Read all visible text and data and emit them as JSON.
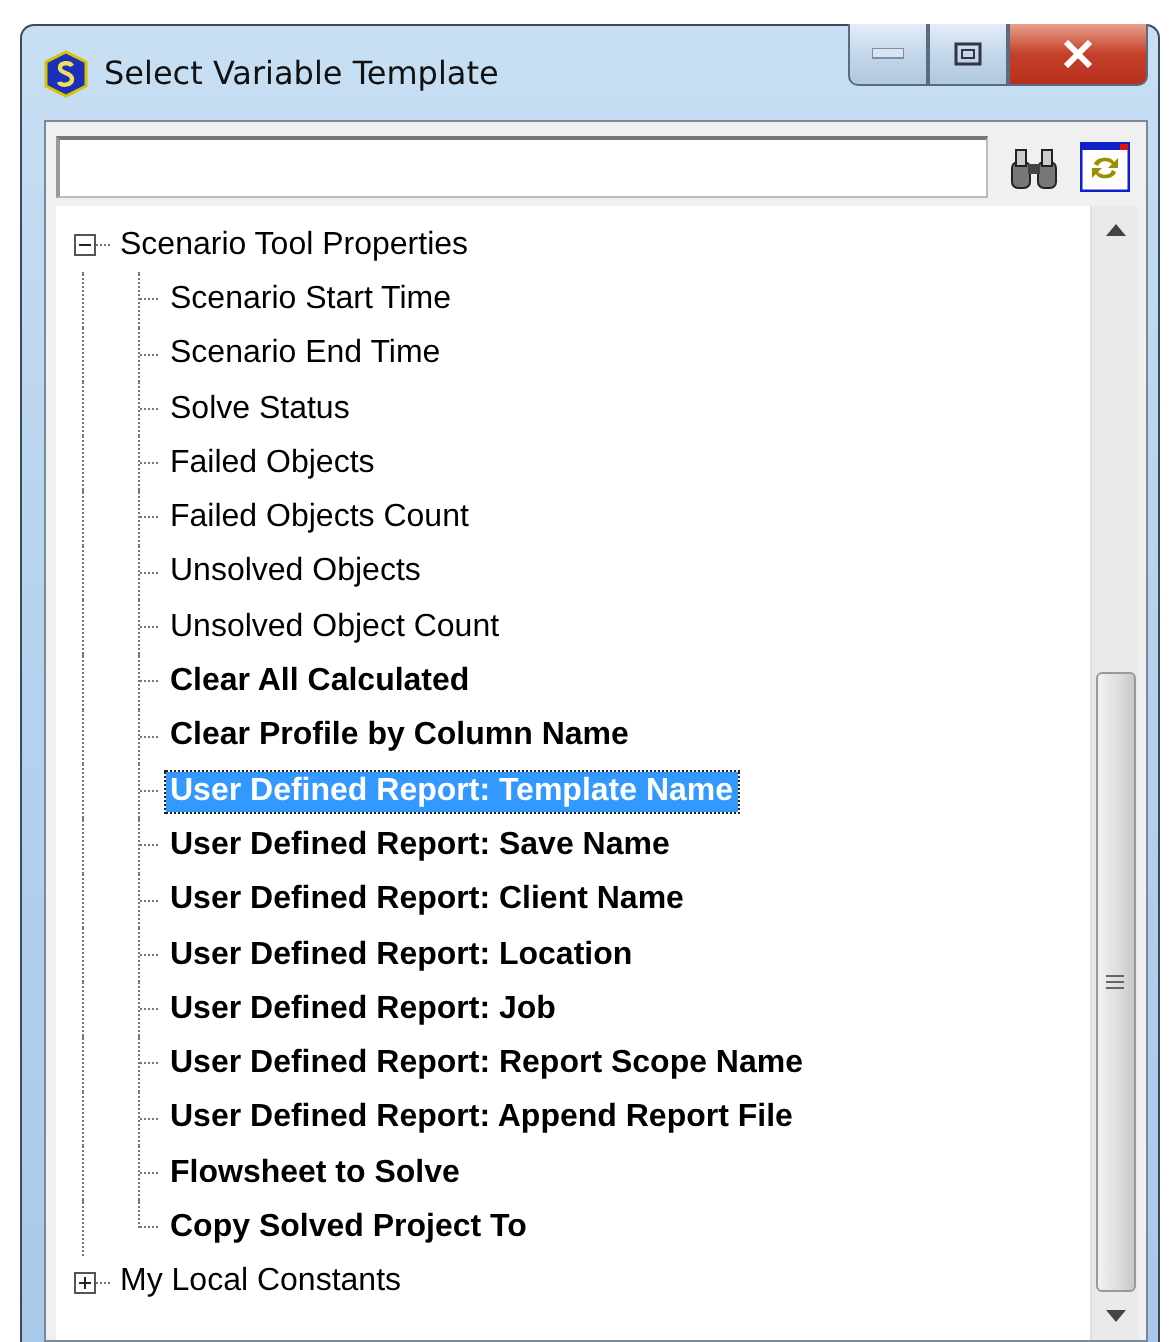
{
  "window": {
    "title": "Select Variable Template"
  },
  "tree": [
    {
      "label": "Scenario Tool Properties",
      "expanded": true,
      "children": [
        {
          "label": "Scenario Start Time",
          "bold": false,
          "selected": false
        },
        {
          "label": "Scenario End Time",
          "bold": false,
          "selected": false
        },
        {
          "label": "Solve Status",
          "bold": false,
          "selected": false
        },
        {
          "label": "Failed Objects",
          "bold": false,
          "selected": false
        },
        {
          "label": "Failed Objects Count",
          "bold": false,
          "selected": false
        },
        {
          "label": "Unsolved Objects",
          "bold": false,
          "selected": false
        },
        {
          "label": "Unsolved Object Count",
          "bold": false,
          "selected": false
        },
        {
          "label": "Clear All Calculated",
          "bold": true,
          "selected": false
        },
        {
          "label": "Clear Profile by Column Name",
          "bold": true,
          "selected": false
        },
        {
          "label": "User Defined Report: Template Name",
          "bold": true,
          "selected": true
        },
        {
          "label": "User Defined Report: Save Name",
          "bold": true,
          "selected": false
        },
        {
          "label": "User Defined Report: Client Name",
          "bold": true,
          "selected": false
        },
        {
          "label": "User Defined Report: Location",
          "bold": true,
          "selected": false
        },
        {
          "label": "User Defined Report: Job",
          "bold": true,
          "selected": false
        },
        {
          "label": "User Defined Report: Report Scope Name",
          "bold": true,
          "selected": false
        },
        {
          "label": "User Defined Report: Append Report File",
          "bold": true,
          "selected": false
        },
        {
          "label": "Flowsheet to Solve",
          "bold": true,
          "selected": false
        },
        {
          "label": "Copy Solved Project To",
          "bold": true,
          "selected": false
        }
      ]
    },
    {
      "label": "My Local Constants",
      "expanded": false
    }
  ]
}
